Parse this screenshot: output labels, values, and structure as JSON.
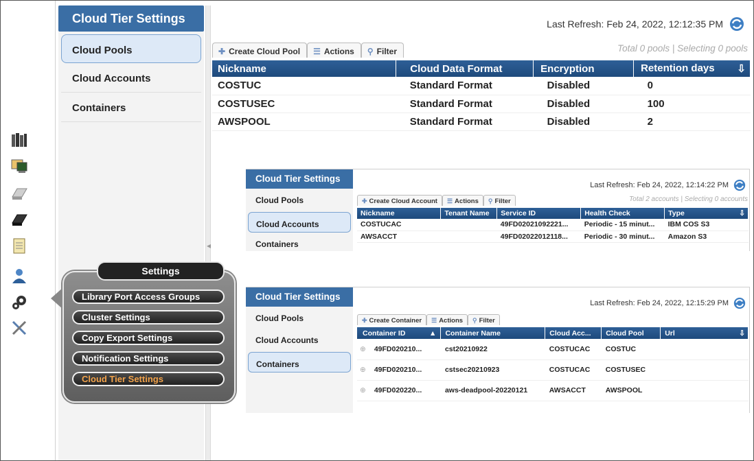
{
  "nav": {
    "title": "Cloud Tier Settings",
    "items": [
      {
        "label": "Cloud Pools",
        "active": true
      },
      {
        "label": "Cloud Accounts",
        "active": false
      },
      {
        "label": "Containers",
        "active": false
      }
    ]
  },
  "main": {
    "last_refresh": "Last Refresh:  Feb 24, 2022, 12:12:35 PM",
    "toolbar": {
      "create": "Create Cloud Pool",
      "actions": "Actions",
      "filter": "Filter"
    },
    "summary": "Total 0 pools | Selecting 0 pools",
    "columns": [
      "Nickname",
      "Cloud Data Format",
      "Encryption",
      "Retention days"
    ],
    "rows": [
      [
        "COSTUC",
        "Standard Format",
        "Disabled",
        "0"
      ],
      [
        "COSTUSEC",
        "Standard Format",
        "Disabled",
        "100"
      ],
      [
        "AWSPOOL",
        "Standard Format",
        "Disabled",
        "2"
      ]
    ]
  },
  "accounts_panel": {
    "title": "Cloud Tier Settings",
    "nav": [
      "Cloud Pools",
      "Cloud Accounts",
      "Containers"
    ],
    "active_index": 1,
    "last_refresh": "Last Refresh:  Feb 24, 2022, 12:14:22 PM",
    "toolbar": {
      "create": "Create Cloud Account",
      "actions": "Actions",
      "filter": "Filter"
    },
    "summary": "Total 2 accounts | Selecting 0 accounts",
    "columns": [
      "Nickname",
      "Tenant Name",
      "Service ID",
      "Health Check",
      "Type"
    ],
    "rows": [
      [
        "COSTUCAC",
        "",
        "49FD02021092221...",
        "Periodic - 15 minut...",
        "IBM COS S3"
      ],
      [
        "AWSACCT",
        "",
        "49FD02022012118...",
        "Periodic - 30 minut...",
        "Amazon S3"
      ]
    ]
  },
  "containers_panel": {
    "title": "Cloud Tier Settings",
    "nav": [
      "Cloud Pools",
      "Cloud Accounts",
      "Containers"
    ],
    "active_index": 2,
    "last_refresh": "Last Refresh:  Feb 24, 2022, 12:15:29 PM",
    "toolbar": {
      "create": "Create Container",
      "actions": "Actions",
      "filter": "Filter"
    },
    "columns": [
      "Container ID",
      "Container Name",
      "Cloud Acc...",
      "Cloud Pool",
      "Url"
    ],
    "rows": [
      [
        "49FD020210...",
        "cst20210922",
        "COSTUCAC",
        "COSTUC",
        ""
      ],
      [
        "49FD020210...",
        "cstsec20210923",
        "COSTUCAC",
        "COSTUSEC",
        ""
      ],
      [
        "49FD020220...",
        "aws-deadpool-20220121",
        "AWSACCT",
        "AWSPOOL",
        ""
      ]
    ]
  },
  "settings_popup": {
    "title": "Settings",
    "items": [
      {
        "label": "Library Port Access Groups",
        "active": false
      },
      {
        "label": "Cluster Settings",
        "active": false
      },
      {
        "label": "Copy Export Settings",
        "active": false
      },
      {
        "label": "Notification Settings",
        "active": false
      },
      {
        "label": "Cloud Tier Settings",
        "active": true
      }
    ]
  },
  "colors": {
    "header_blue": "#3a6ea5",
    "grid_header": "#1e4a7c",
    "active_item": "#f2a24a"
  },
  "icons": [
    "system-icon",
    "monitor-icon",
    "virtual-icon",
    "physical-icon",
    "logs-icon",
    "access-icon",
    "settings-gear-icon",
    "service-tools-icon"
  ]
}
